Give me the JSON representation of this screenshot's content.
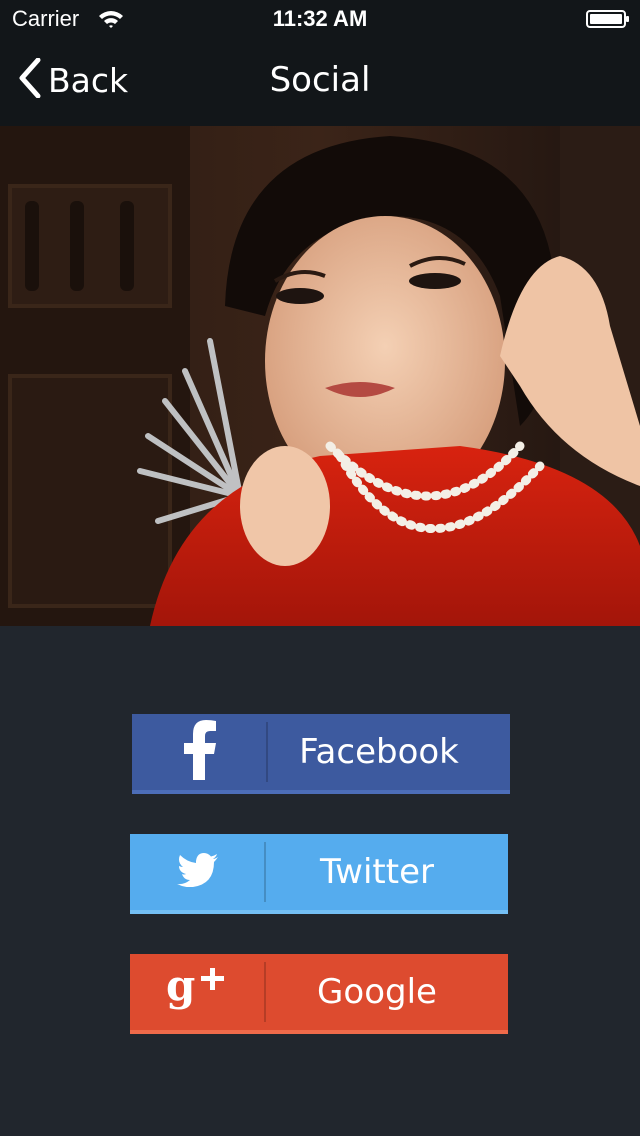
{
  "status_bar": {
    "carrier": "Carrier",
    "time": "11:32 AM"
  },
  "nav": {
    "back_label": "Back",
    "title": "Social"
  },
  "buttons": {
    "facebook": {
      "label": "Facebook",
      "color": "#3d5a9f"
    },
    "twitter": {
      "label": "Twitter",
      "color": "#55acee"
    },
    "google": {
      "label": "Google",
      "color": "#dd4b2f"
    }
  },
  "icons": [
    "wifi-icon",
    "battery-icon",
    "chevron-left-icon",
    "facebook-icon",
    "twitter-icon",
    "google-plus-icon"
  ]
}
